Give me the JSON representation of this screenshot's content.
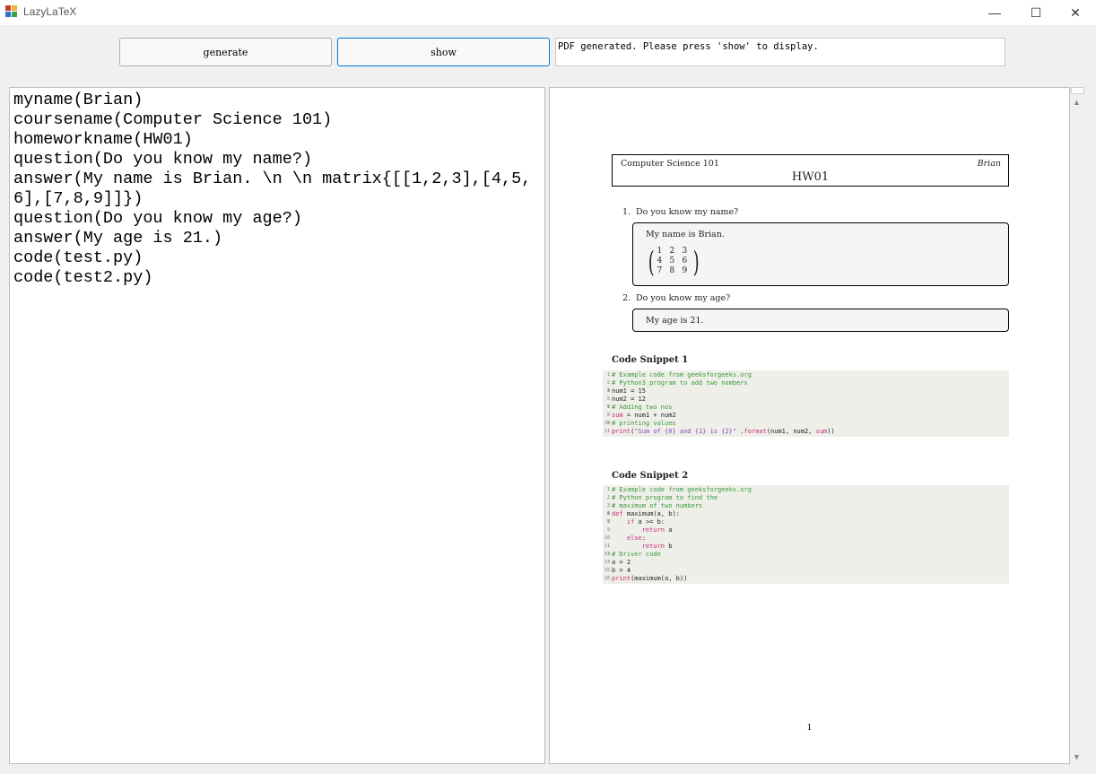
{
  "window": {
    "title": "LazyLaTeX",
    "controls": {
      "minimize": "—",
      "maximize": "☐",
      "close": "✕"
    }
  },
  "toolbar": {
    "generate_label": "generate",
    "show_label": "show",
    "status_text": "PDF generated. Please press 'show' to display."
  },
  "editor": {
    "lines": [
      "myname(Brian)",
      "coursename(Computer Science 101)",
      "homeworkname(HW01)",
      "question(Do you know my name?)",
      "answer(My name is Brian. \\n \\n matrix{[[1,2,3],[4,5,6],[7,8,9]]})",
      "question(Do you know my age?)",
      "answer(My age is 21.)",
      "code(test.py)",
      "code(test2.py)"
    ]
  },
  "document": {
    "course": "Computer Science 101",
    "author": "Brian",
    "homework": "HW01",
    "questions": [
      {
        "num": "1.",
        "text": "Do you know my name?",
        "answer": "My name is Brian."
      },
      {
        "num": "2.",
        "text": "Do you know my age?",
        "answer": "My age is 21."
      }
    ],
    "matrix": [
      "1",
      "2",
      "3",
      "4",
      "5",
      "6",
      "7",
      "8",
      "9"
    ],
    "snippet1": {
      "title": "Code Snippet 1",
      "lines": [
        {
          "n": "1",
          "t": "# Example code from geeksforgeeks.org"
        },
        {
          "n": "2",
          "t": "# Python3 program to add two numbers"
        },
        {
          "n": "3",
          "t": ""
        },
        {
          "n": "4",
          "t": "num1 = 15"
        },
        {
          "n": "5",
          "t": "num2 = 12"
        },
        {
          "n": "6",
          "t": ""
        },
        {
          "n": "7",
          "t": "# Adding two nos"
        },
        {
          "n": "8",
          "t": "sum = num1 + num2"
        },
        {
          "n": "9",
          "t": ""
        },
        {
          "n": "10",
          "t": "# printing values"
        },
        {
          "n": "11",
          "t": "print(\"Sum of {0} and {1} is {2}\" .format(num1, num2, sum))"
        }
      ]
    },
    "snippet2": {
      "title": "Code Snippet 2",
      "lines": [
        {
          "n": "1",
          "t": "# Example code from geeksforgeeks.org"
        },
        {
          "n": "2",
          "t": "# Python program to find the"
        },
        {
          "n": "3",
          "t": "# maximum of two numbers"
        },
        {
          "n": "4",
          "t": ""
        },
        {
          "n": "5",
          "t": ""
        },
        {
          "n": "6",
          "t": "def maximum(a, b):"
        },
        {
          "n": "7",
          "t": ""
        },
        {
          "n": "8",
          "t": "    if a >= b:"
        },
        {
          "n": "9",
          "t": "        return a"
        },
        {
          "n": "10",
          "t": "    else:"
        },
        {
          "n": "11",
          "t": "        return b"
        },
        {
          "n": "12",
          "t": ""
        },
        {
          "n": "13",
          "t": "# Driver code"
        },
        {
          "n": "14",
          "t": "a = 2"
        },
        {
          "n": "15",
          "t": "b = 4"
        },
        {
          "n": "16",
          "t": "print(maximum(a, b))"
        }
      ]
    },
    "page_number": "1"
  },
  "scrollbar": {
    "up_icon": "▲",
    "down_icon": "▼"
  }
}
